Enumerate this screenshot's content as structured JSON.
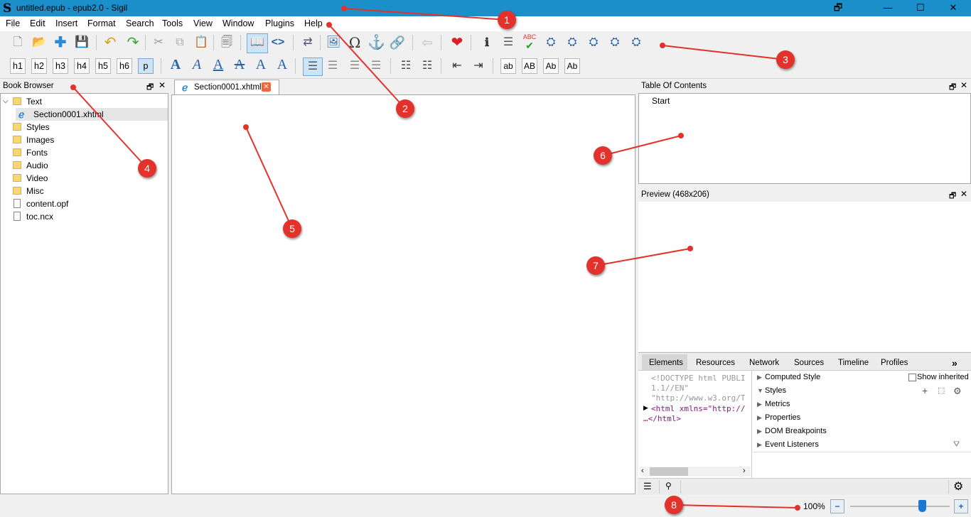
{
  "window": {
    "logo": "S",
    "title": "untitled.epub - epub2.0 - Sigil",
    "restore_glyph": "🗗",
    "minimize_glyph": "—",
    "maximize_glyph": "☐",
    "close_glyph": "✕"
  },
  "menu": [
    "File",
    "Edit",
    "Insert",
    "Format",
    "Search",
    "Tools",
    "View",
    "Window",
    "Plugins",
    "Help"
  ],
  "heading_buttons": [
    "h1",
    "h2",
    "h3",
    "h4",
    "h5",
    "h6",
    "p"
  ],
  "format_buttons": [
    "A",
    "A",
    "A",
    "A",
    "A",
    "A"
  ],
  "case_buttons": [
    "ab",
    "AB",
    "Ab",
    "Ab"
  ],
  "book_browser": {
    "title": "Book Browser",
    "tree": [
      "Text",
      "Section0001.xhtml",
      "Styles",
      "Images",
      "Fonts",
      "Audio",
      "Video",
      "Misc",
      "content.opf",
      "toc.ncx"
    ]
  },
  "editor": {
    "tab_label": "Section0001.xhtml"
  },
  "toc": {
    "title": "Table Of Contents",
    "entry": "Start"
  },
  "preview": {
    "title": "Preview (468x206)"
  },
  "devtools": {
    "tabs": [
      "Elements",
      "Resources",
      "Network",
      "Sources",
      "Timeline",
      "Profiles"
    ],
    "more": "»",
    "code_lines": [
      "<!DOCTYPE html PUBLI",
      "1.1//EN\"",
      "\"http://www.w3.org/T",
      "<html xmlns=\"http://",
      "…</html>"
    ],
    "sections": [
      "Computed Style",
      "Styles",
      "Metrics",
      "Properties",
      "DOM Breakpoints",
      "Event Listeners"
    ],
    "show_inherited": "Show inherited"
  },
  "status": {
    "zoom": "100%",
    "zoom_out": "−",
    "zoom_in": "+",
    "zoom_level": 0.72
  },
  "callouts": [
    "1",
    "2",
    "3",
    "4",
    "5",
    "6",
    "7",
    "8"
  ],
  "colors": {
    "titlebar": "#1a8fc9",
    "callout": "#e3322b"
  }
}
